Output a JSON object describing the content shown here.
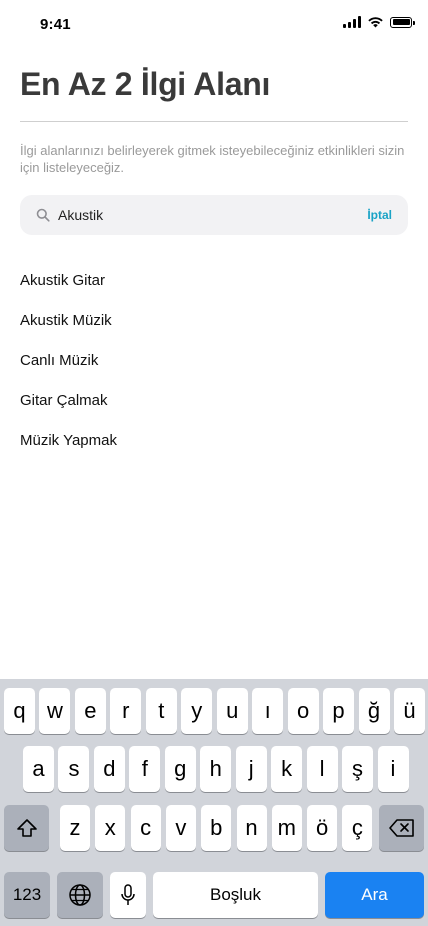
{
  "status_bar": {
    "time": "9:41",
    "signal_icon": "cellular-signal-icon",
    "wifi_icon": "wifi-icon",
    "battery_icon": "battery-icon"
  },
  "header": {
    "title": "En Az 2 İlgi Alanı",
    "description": "İlgi alanlarınızı belirleyerek gitmek isteyebileceğiniz etkinlikleri sizin için listeleyeceğiz."
  },
  "search": {
    "value": "Akustik",
    "placeholder": "",
    "cancel_label": "İptal",
    "icon": "search-icon"
  },
  "results": [
    "Akustik Gitar",
    "Akustik Müzik",
    "Canlı Müzik",
    "Gitar Çalmak",
    "Müzik Yapmak"
  ],
  "keyboard": {
    "row1": [
      "q",
      "w",
      "e",
      "r",
      "t",
      "y",
      "u",
      "ı",
      "o",
      "p",
      "ğ",
      "ü"
    ],
    "row2": [
      "a",
      "s",
      "d",
      "f",
      "g",
      "h",
      "j",
      "k",
      "l",
      "ş",
      "i"
    ],
    "row3": [
      "z",
      "x",
      "c",
      "v",
      "b",
      "n",
      "m",
      "ö",
      "ç"
    ],
    "numbers_label": "123",
    "space_label": "Boşluk",
    "action_label": "Ara",
    "shift_icon": "shift-icon",
    "delete_icon": "delete-icon",
    "globe_icon": "globe-icon",
    "mic_icon": "microphone-icon"
  },
  "colors": {
    "accent": "#1aa3c6",
    "action_key": "#1a82f2",
    "keyboard_bg": "#d1d4da"
  }
}
